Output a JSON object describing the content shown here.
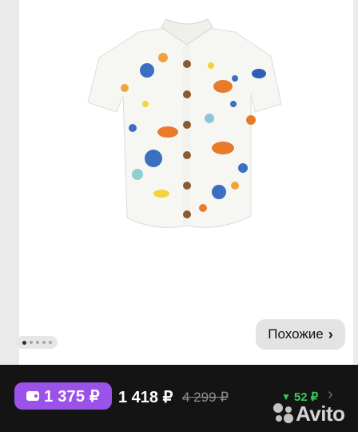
{
  "gallery": {
    "image_alt": "",
    "pager": {
      "count": 5,
      "active": 0
    },
    "similar_button": {
      "label": "Похожие",
      "chevron": "›"
    }
  },
  "bottom_bar": {
    "wallet_price": "1 375 ₽",
    "wallet_icon": "wallet-icon",
    "price": "1 418 ₽",
    "old_price": "4 299 ₽",
    "price_drop": "52 ₽",
    "price_drop_icon": "triangle-down-icon",
    "chevron": "›",
    "watermark": "Avito"
  },
  "colors": {
    "wallet_accent": "#9a52e9",
    "drop_green": "#39c75f",
    "bar_bg": "#141414"
  }
}
